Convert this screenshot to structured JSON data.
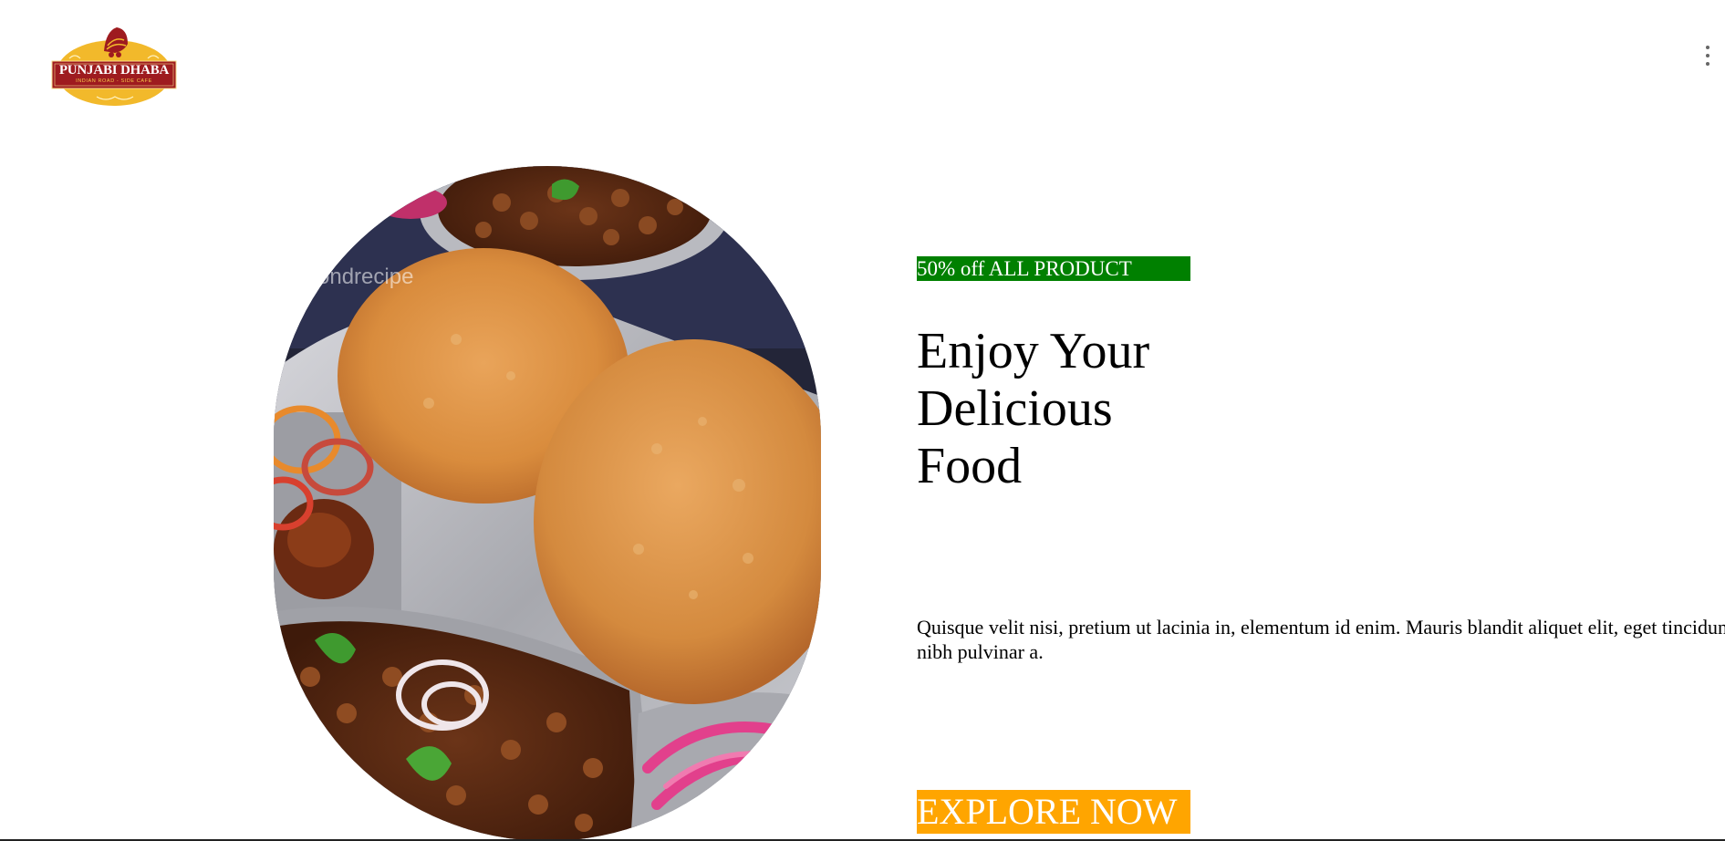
{
  "header": {
    "logo": {
      "brand": "PUNJABI DHABA",
      "tagline": "INDIAN ROAD - SIDE CAFE"
    },
    "menu_icon": "kebab-vertical-icon"
  },
  "hero": {
    "image_watermark": "ondrecipe",
    "badge": "50% off ALL PRODUCT",
    "headline": "Enjoy Your Delicious Food",
    "description": "Quisque velit nisi, pretium ut lacinia in, elementum id enim. Mauris blandit aliquet elit, eget tincidunt nibh pulvinar a.",
    "cta_label": "EXPLORE NOW"
  },
  "colors": {
    "badge_bg": "#008000",
    "cta_bg": "#ffa500",
    "logo_gold": "#f2b92b",
    "logo_red": "#9e1b1f"
  }
}
